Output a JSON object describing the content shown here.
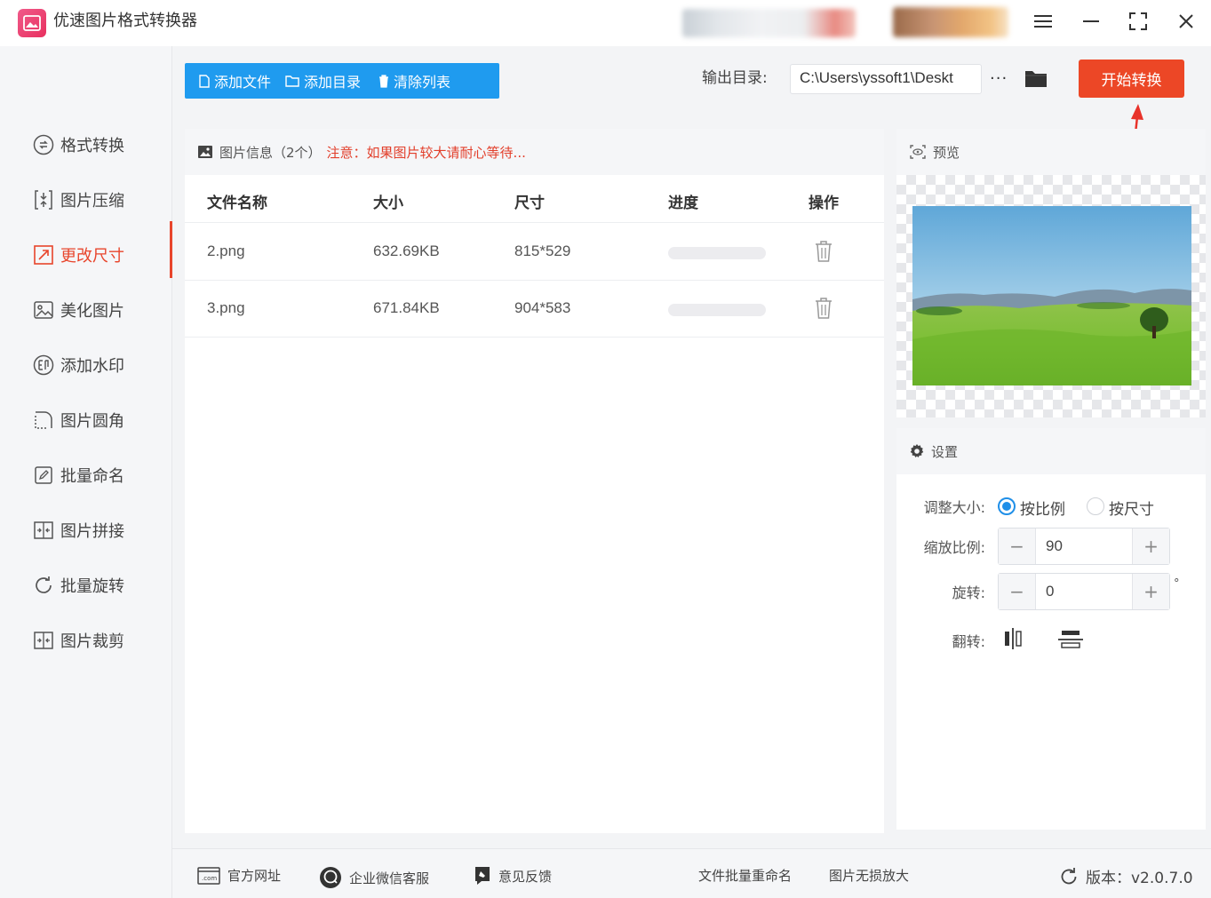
{
  "app": {
    "title": "优速图片格式转换器",
    "window_controls": [
      "menu-icon",
      "minimize-icon",
      "maximize-icon",
      "close-icon"
    ]
  },
  "sidebar": {
    "items": [
      {
        "label": "格式转换",
        "icon": "convert-icon",
        "active": false
      },
      {
        "label": "图片压缩",
        "icon": "compress-icon",
        "active": false
      },
      {
        "label": "更改尺寸",
        "icon": "resize-icon",
        "active": true
      },
      {
        "label": "美化图片",
        "icon": "beautify-icon",
        "active": false
      },
      {
        "label": "添加水印",
        "icon": "watermark-icon",
        "active": false
      },
      {
        "label": "图片圆角",
        "icon": "round-corner-icon",
        "active": false
      },
      {
        "label": "批量命名",
        "icon": "rename-icon",
        "active": false
      },
      {
        "label": "图片拼接",
        "icon": "stitch-icon",
        "active": false
      },
      {
        "label": "批量旋转",
        "icon": "rotate-icon",
        "active": false
      },
      {
        "label": "图片裁剪",
        "icon": "crop-icon",
        "active": false
      }
    ]
  },
  "toolbar": {
    "add_file": "添加文件",
    "add_folder": "添加目录",
    "clear_list": "清除列表",
    "output_label": "输出目录:",
    "output_path": "C:\\Users\\yssoft1\\Deskt",
    "more": "···",
    "start": "开始转换"
  },
  "file_panel": {
    "info_label": "图片信息（2个）",
    "notice": "注意：如果图片较大请耐心等待...",
    "columns": [
      "文件名称",
      "大小",
      "尺寸",
      "进度",
      "操作"
    ],
    "rows": [
      {
        "name": "2.png",
        "size": "632.69KB",
        "dimensions": "815*529",
        "progress": 0
      },
      {
        "name": "3.png",
        "size": "671.84KB",
        "dimensions": "904*583",
        "progress": 0
      }
    ]
  },
  "preview": {
    "title": "预览"
  },
  "settings": {
    "title": "设置",
    "resize_label": "调整大小:",
    "by_ratio": "按比例",
    "by_size": "按尺寸",
    "selected": "by_ratio",
    "scale_label": "缩放比例:",
    "scale_value": "90",
    "rotate_label": "旋转:",
    "rotate_value": "0",
    "rotate_unit": "°",
    "flip_label": "翻转:"
  },
  "footer": {
    "website": "官方网址",
    "wechat": "企业微信客服",
    "feedback": "意见反馈",
    "batch_rename": "文件批量重命名",
    "lossless": "图片无损放大",
    "version": "版本：v2.0.7.0"
  },
  "colors": {
    "accent_blue": "#1f9bef",
    "accent_red": "#ec4726",
    "notice_red": "#e23e2a"
  }
}
